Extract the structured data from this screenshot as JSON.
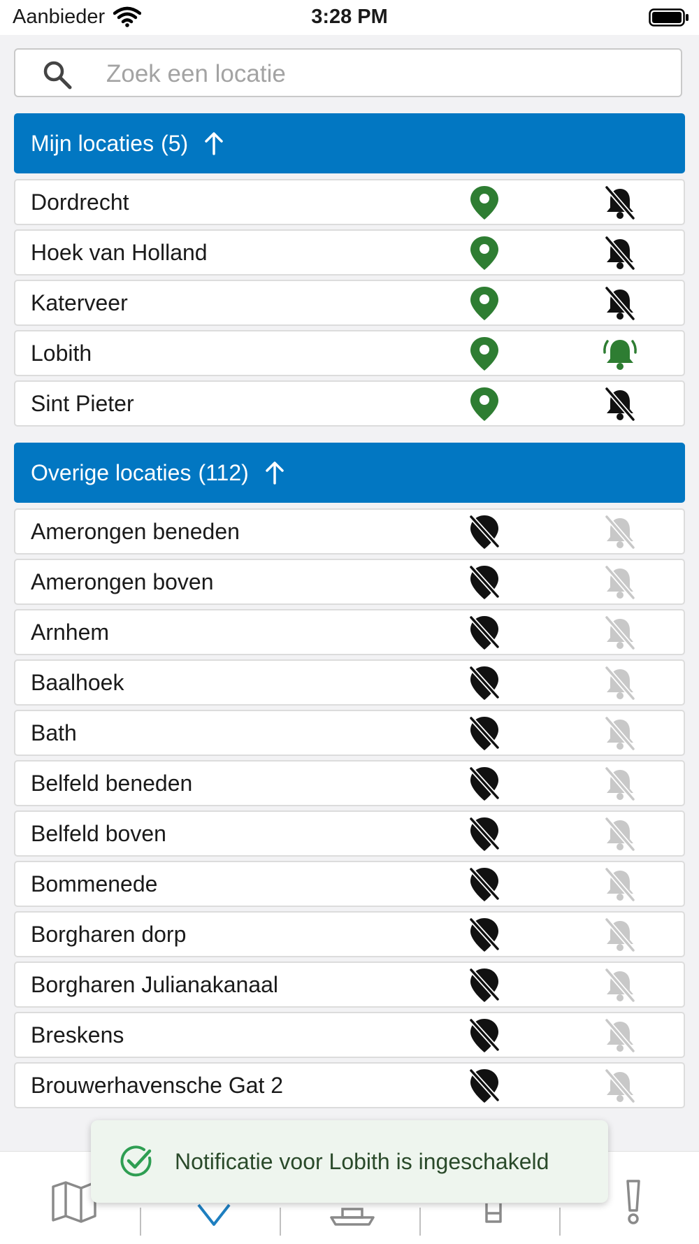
{
  "status_bar": {
    "carrier": "Aanbieder",
    "time": "3:28 PM"
  },
  "search": {
    "placeholder": "Zoek een locatie",
    "value": ""
  },
  "my_locations": {
    "title": "Mijn locaties",
    "count": "(5)",
    "items": [
      {
        "label": "Dordrecht",
        "location": "active",
        "notification": "off"
      },
      {
        "label": "Hoek van Holland",
        "location": "active",
        "notification": "off"
      },
      {
        "label": "Katerveer",
        "location": "active",
        "notification": "off"
      },
      {
        "label": "Lobith",
        "location": "active",
        "notification": "on"
      },
      {
        "label": "Sint Pieter",
        "location": "active",
        "notification": "off"
      }
    ]
  },
  "other_locations": {
    "title": "Overige locaties",
    "count": "(112)",
    "items": [
      {
        "label": "Amerongen beneden",
        "location": "inactive",
        "notification": "disabled"
      },
      {
        "label": "Amerongen boven",
        "location": "inactive",
        "notification": "disabled"
      },
      {
        "label": "Arnhem",
        "location": "inactive",
        "notification": "disabled"
      },
      {
        "label": "Baalhoek",
        "location": "inactive",
        "notification": "disabled"
      },
      {
        "label": "Bath",
        "location": "inactive",
        "notification": "disabled"
      },
      {
        "label": "Belfeld beneden",
        "location": "inactive",
        "notification": "disabled"
      },
      {
        "label": "Belfeld boven",
        "location": "inactive",
        "notification": "disabled"
      },
      {
        "label": "Bommenede",
        "location": "inactive",
        "notification": "disabled"
      },
      {
        "label": "Borgharen dorp",
        "location": "inactive",
        "notification": "disabled"
      },
      {
        "label": "Borgharen Julianakanaal",
        "location": "inactive",
        "notification": "disabled"
      },
      {
        "label": "Breskens",
        "location": "inactive",
        "notification": "disabled"
      },
      {
        "label": "Brouwerhavensche Gat 2",
        "location": "inactive",
        "notification": "disabled"
      }
    ]
  },
  "toast": {
    "message": "Notificatie voor Lobith is ingeschakeld"
  },
  "bottom_nav": [
    "map-icon",
    "locations-check-icon",
    "ship-icon",
    "gauge-icon",
    "alert-icon"
  ],
  "colors": {
    "header_blue": "#0277c2",
    "pin_green": "#2e7d32",
    "bell_active_green": "#2e7d32",
    "icon_dark": "#111111",
    "icon_disabled": "#c8c8c8",
    "nav_active": "#1e7fc0"
  }
}
